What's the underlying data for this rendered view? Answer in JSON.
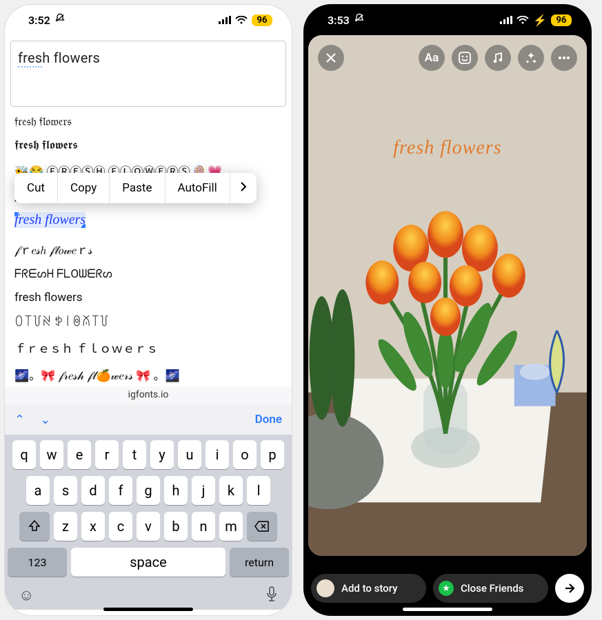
{
  "left": {
    "status": {
      "time": "3:52",
      "battery": "96"
    },
    "input_text_leading": "fres",
    "input_text_trailing": "h flowers",
    "font_variants": [
      "𝔣𝔯𝔢𝔰𝔥 𝔣𝔩𝔬𝔴𝔢𝔯𝔰",
      "𝖋𝖗𝖊𝖘𝖍 𝖋𝖑𝖔𝖜𝖊𝖗𝖘",
      "🐝😂 ⒻⓇⒺⓈⒽ ⒻⓁⓄⓌⒺⓇⓈ 🍭💗",
      "𝒻",
      "fresh flowers",
      "𝒻ｒ𝑒𝓈ℎ 𝒻𝓁𝑜𝓌𝑒ｒ𝓈",
      "ᖴᖇᗴᔕᕼ ᖴᒪOᗯᗴᖇᔕ",
      "fresh flowers",
      "ꄲ꓄꒦ꋊ ꉣ꒐ꉻꊼ꓄꒦",
      "ｆｒｅｓｈ ｆｌｏｗｅｒｓ",
      "🌌。🎀 𝒻𝓇𝑒𝓈𝒽 𝒻𝓁🍊𝓌𝑒𝓇𝓈 🎀 。🌌"
    ],
    "selected_index": 4,
    "context_menu": {
      "cut": "Cut",
      "copy": "Copy",
      "paste": "Paste",
      "autofill": "AutoFill"
    },
    "url": "igfonts.io",
    "toolbar_done": "Done",
    "keyboard": {
      "row1": [
        "q",
        "w",
        "e",
        "r",
        "t",
        "y",
        "u",
        "i",
        "o",
        "p"
      ],
      "row2": [
        "a",
        "s",
        "d",
        "f",
        "g",
        "h",
        "j",
        "k",
        "l"
      ],
      "row3": [
        "z",
        "x",
        "c",
        "v",
        "b",
        "n",
        "m"
      ],
      "numkey": "123",
      "space": "space",
      "return": "return"
    }
  },
  "right": {
    "status": {
      "time": "3:53",
      "battery": "96"
    },
    "story_text": "fresh  flowers",
    "tools": {
      "text": "Aa"
    },
    "add_story": "Add to story",
    "close_friends": "Close Friends"
  }
}
